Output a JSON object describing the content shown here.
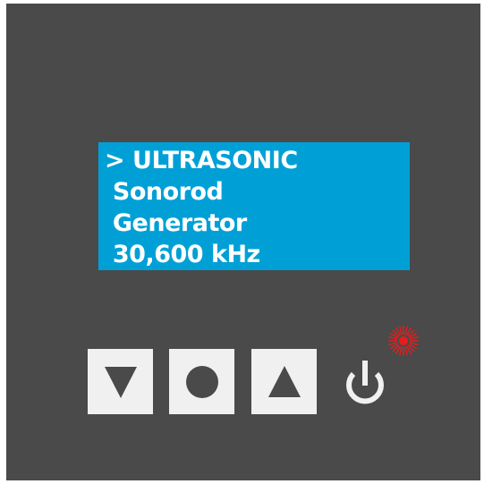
{
  "display": {
    "lines": [
      "> ULTRASONIC",
      " Sonorod",
      " Generator",
      " 30,600 kHz"
    ]
  },
  "keys": {
    "down": {
      "icon": "triangle-down-icon"
    },
    "ok": {
      "icon": "circle-icon"
    },
    "up": {
      "icon": "triangle-up-icon"
    }
  },
  "power": {
    "icon": "power-icon"
  },
  "status_led": {
    "icon": "led-indicator-icon",
    "state": "on",
    "color": "#e81c1c"
  },
  "colors": {
    "panel": "#4a4a4a",
    "lcd_background": "#00a0d6",
    "lcd_text": "#ffffff",
    "key_face": "#f0f0f0",
    "key_symbol": "#4a4a4a",
    "power_symbol": "#f0f0f0"
  }
}
